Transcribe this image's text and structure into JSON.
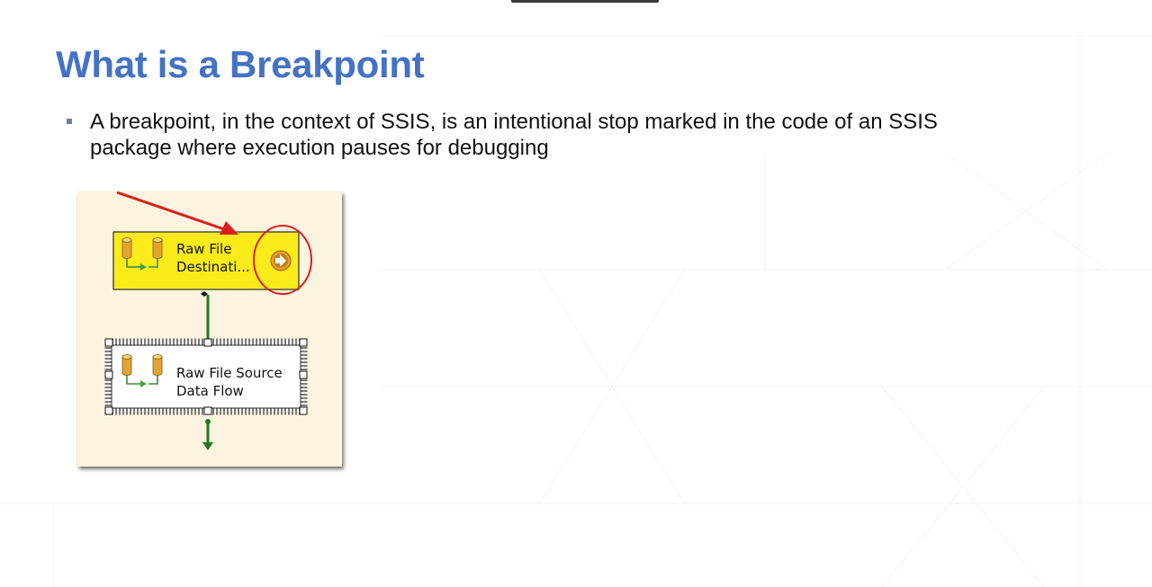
{
  "slide": {
    "title": "What is a Breakpoint",
    "bullets": [
      "A breakpoint, in the context of SSIS, is an intentional stop marked in the code of an SSIS package where execution pauses for debugging"
    ]
  },
  "figure": {
    "task_top": {
      "line1": "Raw File",
      "line2": "Destinati..."
    },
    "task_bottom": {
      "line1": "Raw File Source",
      "line2": "Data Flow"
    }
  },
  "colors": {
    "title": "#4472c4",
    "breakpoint_fill": "#fbeb1b",
    "annotation": "#d91f1f",
    "connector": "#1f7a1f",
    "figure_background": "#fcf4df"
  }
}
